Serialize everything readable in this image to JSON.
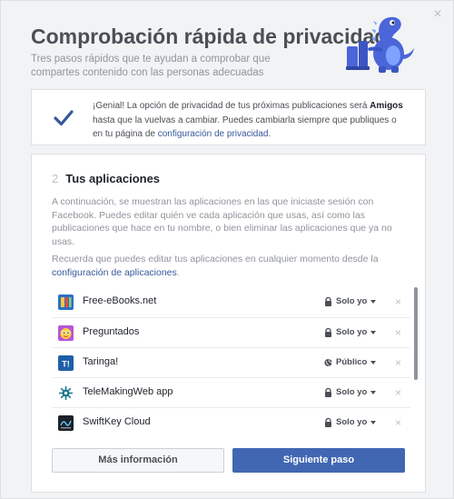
{
  "header": {
    "title": "Comprobación rápida de privacidad",
    "subtitle": "Tres pasos rápidos que te ayudan a comprobar que compartes contenido con las personas adecuadas",
    "close_icon": "×"
  },
  "notice": {
    "prefix": "¡Genial! La opción de privacidad de tus próximas publicaciones será ",
    "audience": "Amigos",
    "suffix": " hasta que la vuelvas a cambiar. Puedes cambiarla siempre que publiques o en tu página de ",
    "link": "configuración de privacidad",
    "end": "."
  },
  "step": {
    "number": "2",
    "title": "Tus aplicaciones",
    "description": "A continuación, se muestran las aplicaciones en las que iniciaste sesión con Facebook. Puedes editar quién ve cada aplicación que usas, así como las publicaciones que hace en tu nombre, o bien eliminar las aplicaciones que ya no usas.",
    "reminder_prefix": "Recuerda que puedes editar tus aplicaciones en cualquier momento desde la ",
    "reminder_link": "configuración de aplicaciones",
    "reminder_end": "."
  },
  "apps": [
    {
      "name": "Free-eBooks.net",
      "privacy": "Solo yo",
      "privacy_icon": "lock-icon",
      "icon": "free-ebooks-icon"
    },
    {
      "name": "Preguntados",
      "privacy": "Solo yo",
      "privacy_icon": "lock-icon",
      "icon": "preguntados-icon"
    },
    {
      "name": "Taringa!",
      "privacy": "Público",
      "privacy_icon": "globe-icon",
      "icon": "taringa-icon"
    },
    {
      "name": "TeleMakingWeb app",
      "privacy": "Solo yo",
      "privacy_icon": "lock-icon",
      "icon": "telemakingweb-icon"
    },
    {
      "name": "SwiftKey Cloud",
      "privacy": "Solo yo",
      "privacy_icon": "lock-icon",
      "icon": "swiftkey-icon"
    }
  ],
  "remove_icon": "×",
  "buttons": {
    "more": "Más información",
    "next": "Siguiente paso"
  },
  "colors": {
    "accent": "#4267b2",
    "link": "#365899",
    "dino": "#4a66d8"
  }
}
